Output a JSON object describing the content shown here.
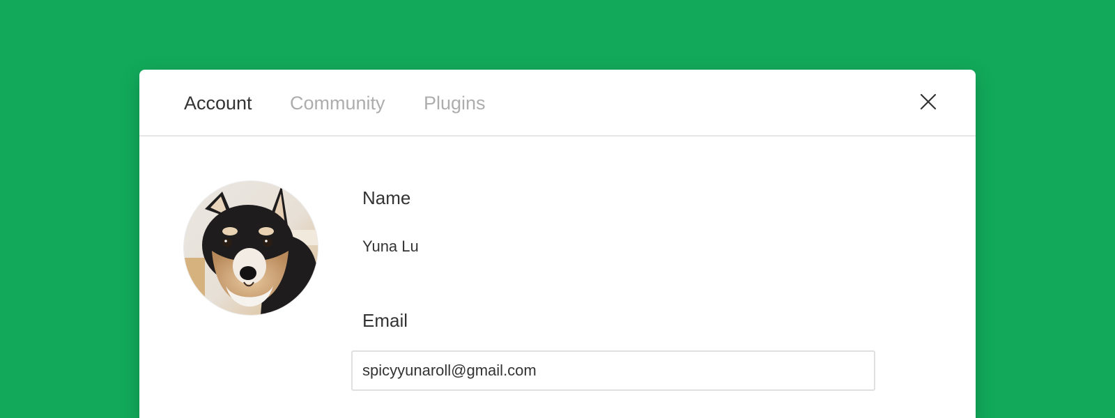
{
  "colors": {
    "background": "#12A95A",
    "modal_bg": "#FFFFFF",
    "text_primary": "#333333",
    "text_muted": "#ADADAD",
    "divider": "#E6E6E6"
  },
  "tabs": [
    {
      "label": "Account",
      "active": true
    },
    {
      "label": "Community",
      "active": false
    },
    {
      "label": "Plugins",
      "active": false
    }
  ],
  "header": {
    "close_icon": "close-icon"
  },
  "profile": {
    "avatar_icon": "avatar-photo"
  },
  "form": {
    "name_label": "Name",
    "name_value": "Yuna Lu",
    "email_label": "Email",
    "email_value": "spicyyunaroll@gmail.com"
  }
}
